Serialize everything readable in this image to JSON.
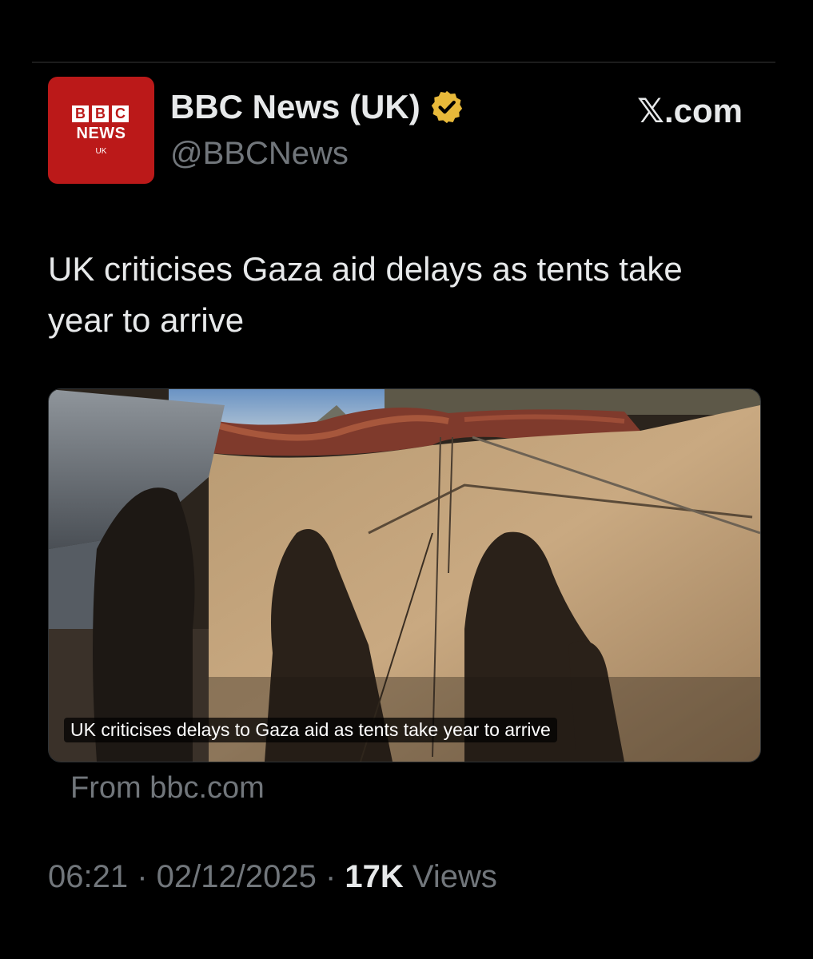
{
  "author": {
    "display_name": "BBC News (UK)",
    "handle": "@BBCNews",
    "avatar": {
      "letters": [
        "B",
        "B",
        "C"
      ],
      "word": "NEWS",
      "region": "UK",
      "color": "#bb1919"
    },
    "verified_icon": "verified-badge-icon",
    "verified_color": "#e8b93a"
  },
  "site_label": "𝕏.com",
  "tweet": {
    "text": "UK criticises Gaza aid delays as tents take year to arrive"
  },
  "link_card": {
    "image_subject": "tent-shadows-photo",
    "caption": "UK criticises delays to Gaza aid as tents take year to arrive",
    "source": "From bbc.com"
  },
  "meta": {
    "time": "06:21",
    "sep1": " · ",
    "date": "02/12/2025",
    "sep2": " · ",
    "views_count": "17K",
    "views_label": " Views"
  }
}
